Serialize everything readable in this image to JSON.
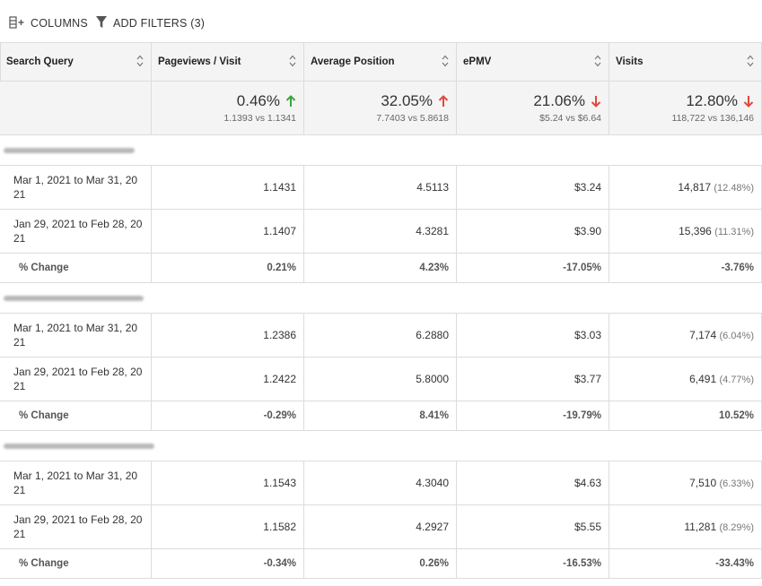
{
  "toolbar": {
    "columns_label": "COLUMNS",
    "filters_label": "ADD FILTERS (3)",
    "columns_icon": "columns-add-icon",
    "filters_icon": "filter-funnel-icon"
  },
  "colors": {
    "up_arrow_green": "#3aa53a",
    "up_arrow_red": "#e2483d",
    "down_arrow_red": "#e2483d",
    "header_bg": "#f4f4f4",
    "grid_line": "#dcdcdc"
  },
  "headers": [
    "Search Query",
    "Pageviews / Visit",
    "Average Position",
    "ePMV",
    "Visits"
  ],
  "summary": [
    {
      "pct": "0.46%",
      "compare": "1.1393 vs 1.1341",
      "direction": "up",
      "arrow_color": "green"
    },
    {
      "pct": "32.05%",
      "compare": "7.7403 vs 5.8618",
      "direction": "up",
      "arrow_color": "red"
    },
    {
      "pct": "21.06%",
      "compare": "$5.24 vs $6.64",
      "direction": "down",
      "arrow_color": "red"
    },
    {
      "pct": "12.80%",
      "compare": "118,722 vs 136,146",
      "direction": "down",
      "arrow_color": "red"
    }
  ],
  "groups": [
    {
      "name_redacted": true,
      "rows": [
        {
          "period": "Mar 1, 2021 to Mar 31, 20 21",
          "pageviews": "1.1431",
          "position": "4.5113",
          "epmv": "$3.24",
          "visits": "14,817",
          "visits_share": "(12.48%)"
        },
        {
          "period": "Jan 29, 2021 to Feb 28, 20 21",
          "pageviews": "1.1407",
          "position": "4.3281",
          "epmv": "$3.90",
          "visits": "15,396",
          "visits_share": "(11.31%)"
        }
      ],
      "change": {
        "label": "% Change",
        "pageviews": "0.21%",
        "position": "4.23%",
        "epmv": "-17.05%",
        "visits": "-3.76%"
      }
    },
    {
      "name_redacted": true,
      "rows": [
        {
          "period": "Mar 1, 2021 to Mar 31, 20 21",
          "pageviews": "1.2386",
          "position": "6.2880",
          "epmv": "$3.03",
          "visits": "7,174",
          "visits_share": "(6.04%)"
        },
        {
          "period": "Jan 29, 2021 to Feb 28, 20 21",
          "pageviews": "1.2422",
          "position": "5.8000",
          "epmv": "$3.77",
          "visits": "6,491",
          "visits_share": "(4.77%)"
        }
      ],
      "change": {
        "label": "% Change",
        "pageviews": "-0.29%",
        "position": "8.41%",
        "epmv": "-19.79%",
        "visits": "10.52%"
      }
    },
    {
      "name_redacted": true,
      "rows": [
        {
          "period": "Mar 1, 2021 to Mar 31, 20 21",
          "pageviews": "1.1543",
          "position": "4.3040",
          "epmv": "$4.63",
          "visits": "7,510",
          "visits_share": "(6.33%)"
        },
        {
          "period": "Jan 29, 2021 to Feb 28, 20 21",
          "pageviews": "1.1582",
          "position": "4.2927",
          "epmv": "$5.55",
          "visits": "11,281",
          "visits_share": "(8.29%)"
        }
      ],
      "change": {
        "label": "% Change",
        "pageviews": "-0.34%",
        "position": "0.26%",
        "epmv": "-16.53%",
        "visits": "-33.43%"
      }
    }
  ]
}
